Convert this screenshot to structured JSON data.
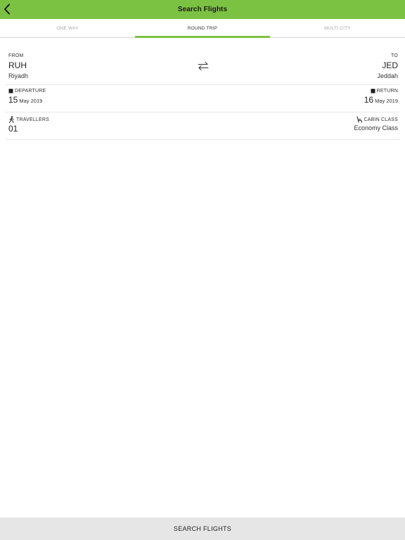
{
  "header": {
    "title": "Search Flights",
    "back_icon": "chevron-left-icon",
    "background_color": "#7cc242"
  },
  "tabs": [
    {
      "label": "ONE WAY",
      "active": false
    },
    {
      "label": "ROUND TRIP",
      "active": true
    },
    {
      "label": "MULTI CITY",
      "active": false
    }
  ],
  "route": {
    "from": {
      "label": "FROM",
      "code": "RUH",
      "city": "Riyadh"
    },
    "to": {
      "label": "TO",
      "code": "JED",
      "city": "Jeddah"
    },
    "swap_icon": "swap-arrows-icon"
  },
  "dates": {
    "departure": {
      "label": "DEPARTURE",
      "day": "15",
      "month_year": "May 2019",
      "icon": "calendar-icon"
    },
    "return": {
      "label": "RETURN",
      "day": "16",
      "month_year": "May 2019",
      "icon": "calendar-icon"
    }
  },
  "passengers": {
    "travellers": {
      "label": "TRAVELLERS",
      "value": "01",
      "icon": "walking-person-icon"
    },
    "cabin": {
      "label": "CABIN CLASS",
      "value": "Economy Class",
      "icon": "seat-icon"
    }
  },
  "search_button": {
    "label": "SEARCH FLIGHTS"
  }
}
